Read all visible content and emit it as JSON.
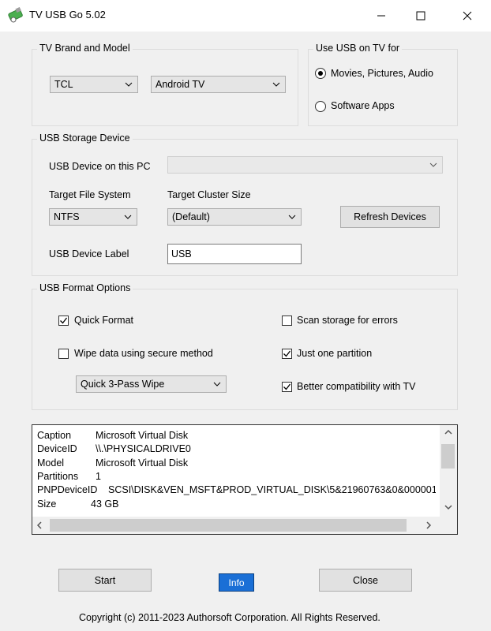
{
  "window": {
    "title": "TV USB Go 5.02"
  },
  "tv_brand": {
    "legend": "TV Brand and Model",
    "brand": "TCL",
    "model": "Android TV"
  },
  "usb_use": {
    "legend": "Use USB on TV for",
    "option1": "Movies, Pictures, Audio",
    "option2": "Software Apps",
    "selected": "Movies, Pictures, Audio"
  },
  "storage": {
    "legend": "USB Storage Device",
    "device_label": "USB Device on this PC",
    "device_value": "",
    "fs_label": "Target File System",
    "fs_value": "NTFS",
    "cluster_label": "Target Cluster Size",
    "cluster_value": "(Default)",
    "refresh": "Refresh Devices",
    "volume_label": "USB Device Label",
    "volume_value": "USB"
  },
  "format": {
    "legend": "USB Format Options",
    "quick": "Quick Format",
    "quick_checked": true,
    "wipe": "Wipe data using secure method",
    "wipe_checked": false,
    "wipe_method": "Quick 3-Pass Wipe",
    "scan": "Scan storage for errors",
    "scan_checked": false,
    "one_partition": "Just one partition",
    "one_partition_checked": true,
    "compat": "Better compatibility with TV",
    "compat_checked": true
  },
  "info": {
    "rows": [
      {
        "key": "Caption",
        "value": "Microsoft Virtual Disk"
      },
      {
        "key": "DeviceID",
        "value": "\\\\.\\PHYSICALDRIVE0"
      },
      {
        "key": "Model",
        "value": "Microsoft Virtual Disk"
      },
      {
        "key": "Partitions",
        "value": "1"
      },
      {
        "key": "PNPDeviceID",
        "value": "SCSI\\DISK&VEN_MSFT&PROD_VIRTUAL_DISK\\5&21960763&0&000001"
      },
      {
        "key": "Size",
        "value": "43 GB"
      }
    ]
  },
  "buttons": {
    "start": "Start",
    "info": "Info",
    "close": "Close"
  },
  "footer": {
    "copyright": "Copyright (c) 2011-2023 Authorsoft Corporation. All Rights Reserved."
  }
}
